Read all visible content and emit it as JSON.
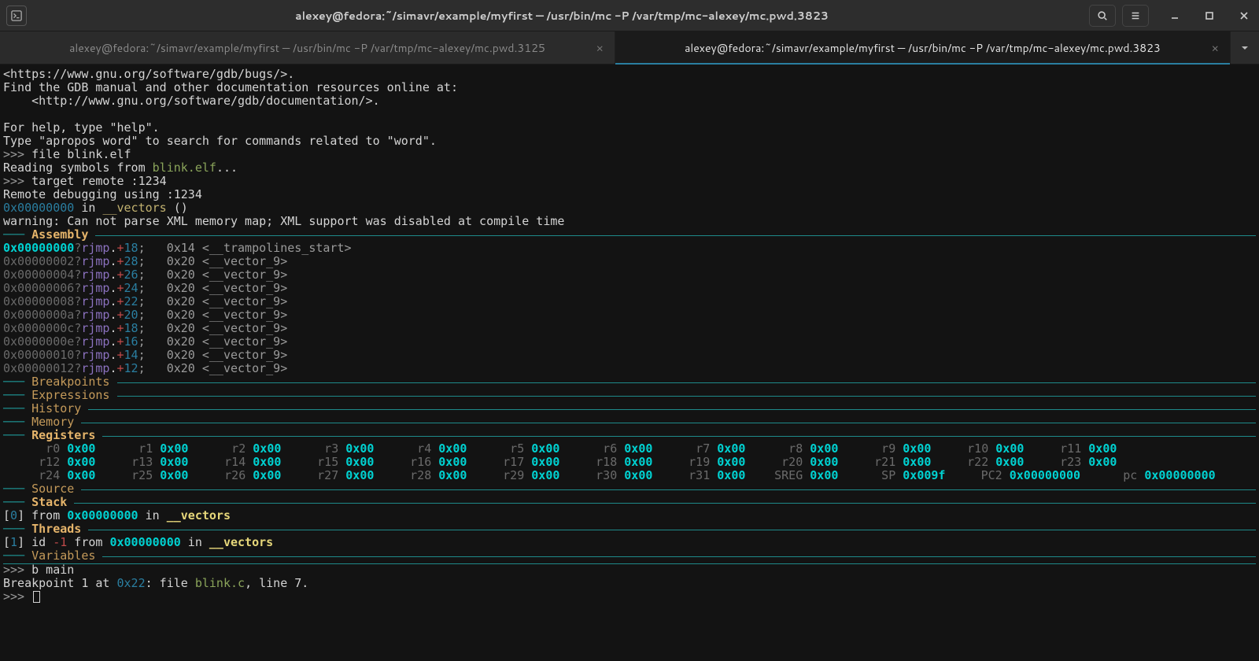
{
  "window": {
    "title": "alexey@fedora:~/simavr/example/myfirst — /usr/bin/mc -P /var/tmp/mc-alexey/mc.pwd.3823"
  },
  "tabs": [
    {
      "label": "alexey@fedora:~/simavr/example/myfirst — /usr/bin/mc -P /var/tmp/mc-alexey/mc.pwd.3125",
      "active": false
    },
    {
      "label": "alexey@fedora:~/simavr/example/myfirst — /usr/bin/mc -P /var/tmp/mc-alexey/mc.pwd.3823",
      "active": true
    }
  ],
  "intro": {
    "l1": "<https://www.gnu.org/software/gdb/bugs/>.",
    "l2": "Find the GDB manual and other documentation resources online at:",
    "l3": "    <http://www.gnu.org/software/gdb/documentation/>.",
    "l5": "For help, type \"help\".",
    "l6": "Type \"apropos word\" to search for commands related to \"word\"."
  },
  "prompt": ">>> ",
  "cmds": {
    "file": "file blink.elf",
    "read_pre": "Reading symbols from ",
    "read_file": "blink.elf",
    "read_post": "...",
    "target": "target remote :1234",
    "remote": "Remote debugging using :1234",
    "pc_addr": "0x00000000",
    "pc_in": " in ",
    "pc_fn": "__vectors",
    "pc_tail": " ()",
    "warn": "warning: Can not parse XML memory map; XML support was disabled at compile time",
    "bmain": "b main",
    "bp_pre": "Breakpoint 1 at ",
    "bp_addr": "0x22",
    "bp_mid": ": file ",
    "bp_file": "blink.c",
    "bp_post": ", line 7."
  },
  "sections": {
    "assembly": "Assembly",
    "breakpoints": "Breakpoints",
    "expressions": "Expressions",
    "history": "History",
    "memory": "Memory",
    "registers": "Registers",
    "source": "Source",
    "stack": "Stack",
    "threads": "Threads",
    "variables": "Variables"
  },
  "asm": [
    {
      "addr": "0x00000000",
      "q": "?",
      "mn": "rjmp",
      "off": "18",
      "c": ";   0x14 <__trampolines_start>",
      "hi": true
    },
    {
      "addr": "0x00000002",
      "q": "?",
      "mn": "rjmp",
      "off": "28",
      "c": ";   0x20 <__vector_9>",
      "hi": false
    },
    {
      "addr": "0x00000004",
      "q": "?",
      "mn": "rjmp",
      "off": "26",
      "c": ";   0x20 <__vector_9>",
      "hi": false
    },
    {
      "addr": "0x00000006",
      "q": "?",
      "mn": "rjmp",
      "off": "24",
      "c": ";   0x20 <__vector_9>",
      "hi": false
    },
    {
      "addr": "0x00000008",
      "q": "?",
      "mn": "rjmp",
      "off": "22",
      "c": ";   0x20 <__vector_9>",
      "hi": false
    },
    {
      "addr": "0x0000000a",
      "q": "?",
      "mn": "rjmp",
      "off": "20",
      "c": ";   0x20 <__vector_9>",
      "hi": false
    },
    {
      "addr": "0x0000000c",
      "q": "?",
      "mn": "rjmp",
      "off": "18",
      "c": ";   0x20 <__vector_9>",
      "hi": false
    },
    {
      "addr": "0x0000000e",
      "q": "?",
      "mn": "rjmp",
      "off": "16",
      "c": ";   0x20 <__vector_9>",
      "hi": false
    },
    {
      "addr": "0x00000010",
      "q": "?",
      "mn": "rjmp",
      "off": "14",
      "c": ";   0x20 <__vector_9>",
      "hi": false
    },
    {
      "addr": "0x00000012",
      "q": "?",
      "mn": "rjmp",
      "off": "12",
      "c": ";   0x20 <__vector_9>",
      "hi": false
    }
  ],
  "registers": {
    "row1": [
      {
        "n": "r0",
        "v": "0x00"
      },
      {
        "n": "r1",
        "v": "0x00"
      },
      {
        "n": "r2",
        "v": "0x00"
      },
      {
        "n": "r3",
        "v": "0x00"
      },
      {
        "n": "r4",
        "v": "0x00"
      },
      {
        "n": "r5",
        "v": "0x00"
      },
      {
        "n": "r6",
        "v": "0x00"
      },
      {
        "n": "r7",
        "v": "0x00"
      },
      {
        "n": "r8",
        "v": "0x00"
      },
      {
        "n": "r9",
        "v": "0x00"
      },
      {
        "n": "r10",
        "v": "0x00"
      },
      {
        "n": "r11",
        "v": "0x00"
      }
    ],
    "row2": [
      {
        "n": "r12",
        "v": "0x00"
      },
      {
        "n": "r13",
        "v": "0x00"
      },
      {
        "n": "r14",
        "v": "0x00"
      },
      {
        "n": "r15",
        "v": "0x00"
      },
      {
        "n": "r16",
        "v": "0x00"
      },
      {
        "n": "r17",
        "v": "0x00"
      },
      {
        "n": "r18",
        "v": "0x00"
      },
      {
        "n": "r19",
        "v": "0x00"
      },
      {
        "n": "r20",
        "v": "0x00"
      },
      {
        "n": "r21",
        "v": "0x00"
      },
      {
        "n": "r22",
        "v": "0x00"
      },
      {
        "n": "r23",
        "v": "0x00"
      }
    ],
    "row3": [
      {
        "n": "r24",
        "v": "0x00"
      },
      {
        "n": "r25",
        "v": "0x00"
      },
      {
        "n": "r26",
        "v": "0x00"
      },
      {
        "n": "r27",
        "v": "0x00"
      },
      {
        "n": "r28",
        "v": "0x00"
      },
      {
        "n": "r29",
        "v": "0x00"
      },
      {
        "n": "r30",
        "v": "0x00"
      },
      {
        "n": "r31",
        "v": "0x00"
      },
      {
        "n": "SREG",
        "v": "0x00"
      },
      {
        "n": "SP",
        "v": "0x009f"
      },
      {
        "n": "PC2",
        "v": "0x00000000"
      },
      {
        "n": "pc",
        "v": "0x00000000"
      }
    ]
  },
  "stack": {
    "idx": "0",
    "from": "from ",
    "addr": "0x00000000",
    "in": " in ",
    "fn": "__vectors"
  },
  "threads": {
    "idx": "1",
    "id_lbl": "id ",
    "id": "-1",
    "from": " from ",
    "addr": "0x00000000",
    "in": " in ",
    "fn": "__vectors"
  }
}
